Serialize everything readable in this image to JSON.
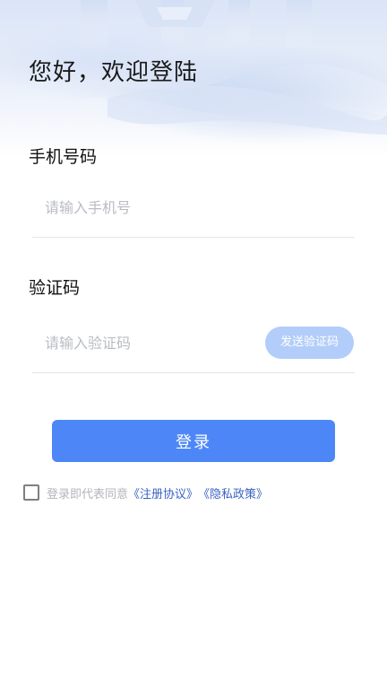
{
  "header": {
    "greeting": "您好，欢迎登陆"
  },
  "phone": {
    "label": "手机号码",
    "placeholder": "请输入手机号",
    "value": ""
  },
  "code": {
    "label": "验证码",
    "placeholder": "请输入验证码",
    "value": "",
    "send_button": "发送验证码"
  },
  "login": {
    "button_label": "登录"
  },
  "agreement": {
    "checked": false,
    "prefix": "登录即代表同意",
    "terms_link": "《注册协议》",
    "privacy_link": "《隐私政策》"
  },
  "colors": {
    "primary": "#4d87f7",
    "send_button_disabled": "#b3cdfa",
    "link": "#3a63c4",
    "placeholder": "#b9bcc3"
  }
}
